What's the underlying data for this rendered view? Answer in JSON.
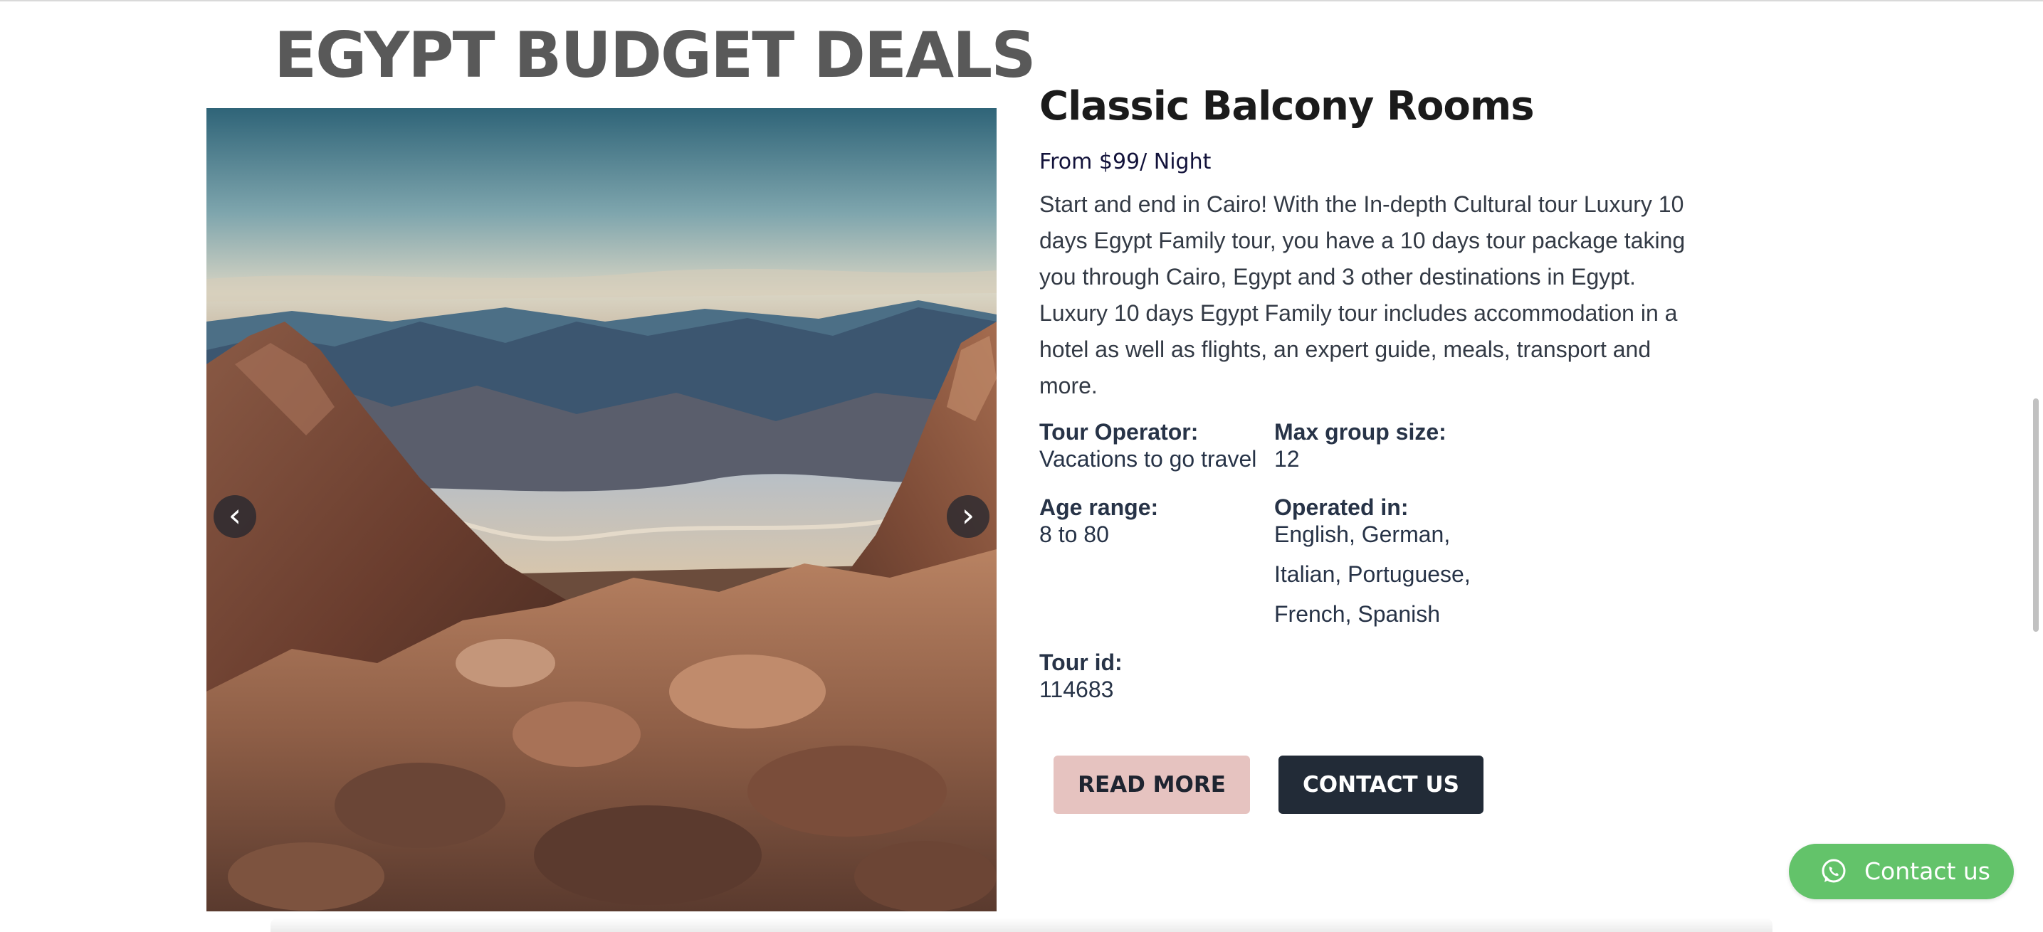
{
  "section": {
    "title": "EGYPT BUDGET DEALS"
  },
  "gallery": {
    "image_alt": "Desert mountains landscape at sunrise",
    "prev_icon": "‹",
    "next_icon": "›"
  },
  "offer": {
    "title": "Classic Balcony Rooms",
    "price": "From $99/ Night",
    "description": "Start and end in Cairo! With the In-depth Cultural tour Luxury 10 days Egypt Family tour, you have a 10 days tour package taking you through Cairo, Egypt and 3 other destinations in Egypt. Luxury 10 days Egypt Family tour includes accommodation in a hotel as well as flights, an expert guide, meals, transport and more."
  },
  "facts": {
    "operator_label": "Tour Operator:",
    "operator_value": "Vacations to go travel",
    "group_label": "Max group size:",
    "group_value": "12",
    "age_label": "Age range:",
    "age_value": "8 to 80",
    "languages_label": "Operated in:",
    "languages_line1": "English, German,",
    "languages_line2": "Italian, Portuguese,",
    "languages_line3": "French, Spanish",
    "tour_id_label": "Tour id:",
    "tour_id_value": "114683"
  },
  "actions": {
    "read_more": "READ MORE",
    "contact_us": "CONTACT US"
  },
  "whatsapp": {
    "label": "Contact us",
    "icon": "whatsapp-icon"
  },
  "colors": {
    "read_more_bg": "#e6c3c0",
    "contact_bg": "#222b37",
    "whatsapp_bg": "#63c36a",
    "title_gray": "#595959"
  }
}
